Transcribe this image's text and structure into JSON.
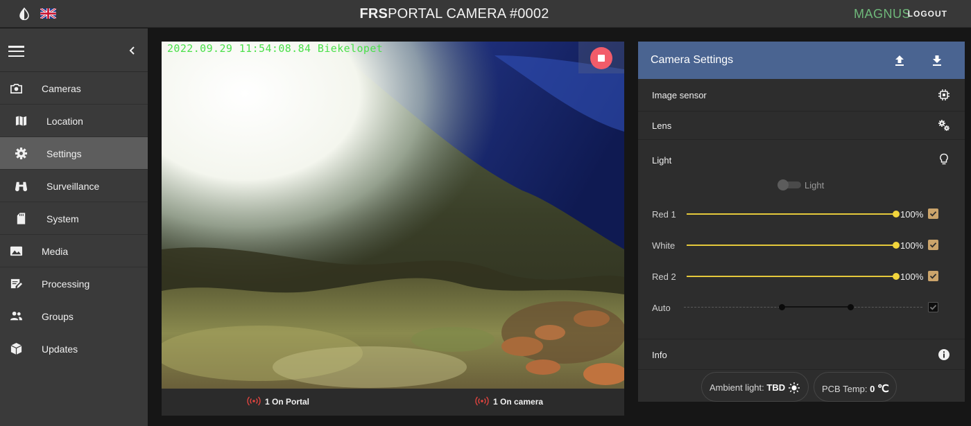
{
  "header": {
    "title_bold": "FRS",
    "title_light": "PORTAL",
    "title_rest": "CAMERA #0002",
    "user": "MAGNUS",
    "logout": "LOGOUT",
    "theme_icon": "contrast-drop-icon",
    "language_icon": "uk-flag-icon"
  },
  "sidebar": {
    "menu_icon": "hamburger-icon",
    "collapse_icon": "chevron-left-icon",
    "items": [
      {
        "label": "Cameras",
        "icon": "camera-icon"
      },
      {
        "label": "Location",
        "icon": "map-icon"
      },
      {
        "label": "Settings",
        "icon": "gear-icon",
        "active": true
      },
      {
        "label": "Surveillance",
        "icon": "binoculars-icon"
      },
      {
        "label": "System",
        "icon": "sd-card-icon"
      },
      {
        "label": "Media",
        "icon": "image-icon"
      },
      {
        "label": "Processing",
        "icon": "edit-note-icon"
      },
      {
        "label": "Groups",
        "icon": "people-icon"
      },
      {
        "label": "Updates",
        "icon": "package-icon"
      }
    ]
  },
  "video": {
    "timestamp": "2022.09.29 11:54:08.84 Biekelopet",
    "stop_icon": "stop-icon",
    "footer": {
      "portal": "1 On Portal",
      "camera": "1 On camera"
    }
  },
  "panel": {
    "title": "Camera Settings",
    "upload_icon": "upload-icon",
    "download_icon": "download-icon",
    "sections": {
      "image_sensor": "Image sensor",
      "lens": "Lens",
      "light": "Light",
      "info": "Info"
    },
    "light_toggle": {
      "label": "Light",
      "on": false
    },
    "sliders": [
      {
        "label": "Red 1",
        "value_text": "100%",
        "value": 100,
        "checked": true
      },
      {
        "label": "White",
        "value_text": "100%",
        "value": 100,
        "checked": true
      },
      {
        "label": "Red 2",
        "value_text": "100%",
        "value": 100,
        "checked": true
      }
    ],
    "auto": {
      "label": "Auto",
      "range_low": 0.41,
      "range_high": 0.7,
      "checked": true
    },
    "info": {
      "ambient_label": "Ambient light:",
      "ambient_value": "TBD",
      "pcb_label": "PCB Temp:",
      "pcb_value": "0",
      "pcb_unit": "℃"
    }
  },
  "colors": {
    "accent": "#4a6491",
    "user": "#6fb87a",
    "slider": "#f2d53c",
    "stop": "#f25c6a",
    "signal": "#e0443f"
  }
}
